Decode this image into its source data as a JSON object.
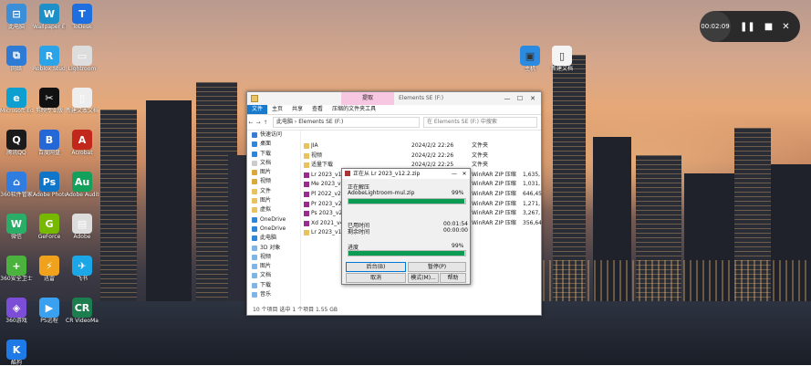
{
  "recorder": {
    "time": "00:02:09",
    "pause_icon": "pause-icon",
    "stop_icon": "stop-icon",
    "close_icon": "close-icon"
  },
  "desktop_left": [
    {
      "label": "此电脑",
      "color": "#3b8fd9",
      "glyph": "⊟"
    },
    {
      "label": "Wallpaper Engine",
      "color": "#1e90c9",
      "glyph": "W"
    },
    {
      "label": "ToDesk",
      "color": "#1d6fe0",
      "glyph": "T"
    },
    {
      "label": "网络",
      "color": "#2e7bd6",
      "glyph": "⧉"
    },
    {
      "label": "Roblox Studio",
      "color": "#2aa3e8",
      "glyph": "R"
    },
    {
      "label": "Lightroom",
      "color": "#ddd",
      "glyph": "▭"
    },
    {
      "label": "Microsoft Edge",
      "color": "#0d9fcf",
      "glyph": "e"
    },
    {
      "label": "剪映专业版",
      "color": "#111",
      "glyph": "✂"
    },
    {
      "label": "新建文本文档",
      "color": "#eee",
      "glyph": "▯"
    },
    {
      "label": "腾讯QQ",
      "color": "#1b1b1b",
      "glyph": "Q"
    },
    {
      "label": "百度网盘",
      "color": "#2468d8",
      "glyph": "B"
    },
    {
      "label": "Acrobat",
      "color": "#c2271c",
      "glyph": "A"
    },
    {
      "label": "360软件管家",
      "color": "#2f7de1",
      "glyph": "⌂"
    },
    {
      "label": "Adobe Photoshop",
      "color": "#0f75c9",
      "glyph": "Ps"
    },
    {
      "label": "Adobe Audition",
      "color": "#12a05b",
      "glyph": "Au"
    },
    {
      "label": "微信",
      "color": "#2aae67",
      "glyph": "W"
    },
    {
      "label": "GeForce",
      "color": "#76b900",
      "glyph": "G"
    },
    {
      "label": "Adobe",
      "color": "#ddd",
      "glyph": "▤"
    },
    {
      "label": "360安全卫士",
      "color": "#4bb33d",
      "glyph": "+"
    },
    {
      "label": "迅雷",
      "color": "#f0a21c",
      "glyph": "⚡"
    },
    {
      "label": "飞书",
      "color": "#1ba6e8",
      "glyph": "✈"
    },
    {
      "label": "360游戏",
      "color": "#7c4dd6",
      "glyph": "◈"
    },
    {
      "label": "PS远程",
      "color": "#3aa1f0",
      "glyph": "▶"
    },
    {
      "label": "CR VideoMat",
      "color": "#1c7d4f",
      "glyph": "CR"
    },
    {
      "label": "酷狗",
      "color": "#1d7ae6",
      "glyph": "K"
    }
  ],
  "desktop_right": [
    {
      "label": "主机",
      "color": "#2b8be0",
      "glyph": "▣"
    },
    {
      "label": "新建文档",
      "color": "#f4f4f4",
      "glyph": "▯"
    }
  ],
  "explorer": {
    "ctx_tab": "提取",
    "title": "Elements SE (F:)",
    "ribbon_tabs": [
      "文件",
      "主页",
      "共享",
      "查看",
      "压缩的文件夹工具"
    ],
    "address": "此电脑 › Elements SE (F:)",
    "search_placeholder": "在 Elements SE (F:) 中搜索",
    "nav_items": [
      {
        "label": "快速访问",
        "color": "#3a7bd5"
      },
      {
        "label": "桌面",
        "color": "#2f86d9"
      },
      {
        "label": "下载",
        "color": "#2f86d9"
      },
      {
        "label": "文档",
        "color": "#ccc"
      },
      {
        "label": "图片",
        "color": "#d9a83a"
      },
      {
        "label": "视频",
        "color": "#d9a83a"
      },
      {
        "label": "文件",
        "color": "#e8c25d"
      },
      {
        "label": "图片",
        "color": "#e8c25d"
      },
      {
        "label": "虚拟",
        "color": "#e8c25d"
      },
      {
        "label": "OneDrive",
        "color": "#2f86d9"
      },
      {
        "label": "OneDrive",
        "color": "#2f86d9"
      },
      {
        "label": "此电脑",
        "color": "#2f86d9"
      },
      {
        "label": "3D 对象",
        "color": "#7fb5e6"
      },
      {
        "label": "视频",
        "color": "#7fb5e6"
      },
      {
        "label": "图片",
        "color": "#7fb5e6"
      },
      {
        "label": "文档",
        "color": "#7fb5e6"
      },
      {
        "label": "下载",
        "color": "#7fb5e6"
      },
      {
        "label": "音乐",
        "color": "#7fb5e6"
      }
    ],
    "files": [
      {
        "name": "JIA",
        "date": "2024/2/2 22:26",
        "type": "文件夹",
        "size": "",
        "icon": "#e8c25d"
      },
      {
        "name": "视频",
        "date": "2024/2/2 22:26",
        "type": "文件夹",
        "size": "",
        "icon": "#e8c25d"
      },
      {
        "name": "适量下载",
        "date": "2024/2/2 22:25",
        "type": "文件夹",
        "size": "",
        "icon": "#e8c25d"
      },
      {
        "name": "Lr 2023_v12.2.zip",
        "date": "",
        "type": "WinRAR ZIP 压缩",
        "size": "1,635,",
        "icon": "#9b2b8f"
      },
      {
        "name": "Me 2023_v23",
        "date": "",
        "type": "WinRAR ZIP 压缩",
        "size": "1,031,",
        "icon": "#9b2b8f"
      },
      {
        "name": "Pl 2022_v22.6",
        "date": "",
        "type": "WinRAR ZIP 压缩",
        "size": "646,45",
        "icon": "#9b2b8f"
      },
      {
        "name": "Pr 2023_v24",
        "date": "",
        "type": "WinRAR ZIP 压缩",
        "size": "1,271,",
        "icon": "#9b2b8f"
      },
      {
        "name": "Ps 2023_v24.",
        "date": "",
        "type": "WinRAR ZIP 压缩",
        "size": "3,267,",
        "icon": "#9b2b8f"
      },
      {
        "name": "Xd 2021_v42",
        "date": "",
        "type": "WinRAR ZIP 压缩",
        "size": "356,64",
        "icon": "#9b2b8f"
      },
      {
        "name": "Lr 2023_v12.",
        "date": "",
        "type": "",
        "size": "",
        "icon": "#e8c25d"
      }
    ],
    "status": "10 个项目  选中 1 个项目  1.55 GB"
  },
  "progress": {
    "title": "正在从 Lr 2023_v12.2.zip",
    "line_label": "正在解压",
    "filename": "AdobeLightroom-mul.zip",
    "file_percent": "99%",
    "file_fill": 0.99,
    "elapsed_label": "已用时间",
    "elapsed": "00:01:54",
    "remaining_label": "剩余时间",
    "remaining": "00:00:00",
    "progress_label": "进度",
    "total_percent": "99%",
    "total_fill": 0.99,
    "btn_background": "后台(B)",
    "btn_pause": "暂停(P)",
    "btn_cancel": "取消",
    "btn_mode": "模式(M)...",
    "btn_help": "帮助"
  }
}
